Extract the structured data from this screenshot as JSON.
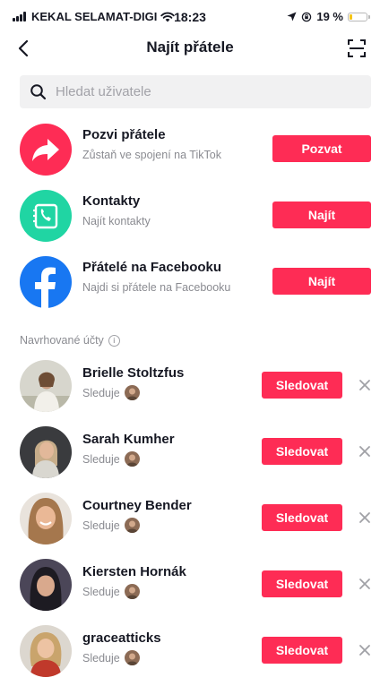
{
  "status_bar": {
    "carrier": "KEKAL SELAMAT-DIGI",
    "time": "18:23",
    "battery_text": "19 %",
    "battery_level_percent": 19,
    "icons": [
      "signal-bars-icon",
      "wifi-icon",
      "location-arrow-icon",
      "orientation-lock-icon",
      "battery-icon"
    ]
  },
  "header": {
    "title": "Najít přátele",
    "icons": [
      "back-arrow-icon",
      "qr-scan-icon"
    ]
  },
  "search": {
    "placeholder": "Hledat uživatele",
    "value": "",
    "icon": "search-icon"
  },
  "invite_options": [
    {
      "title": "Pozvi přátele",
      "subtitle": "Zůstaň ve spojení na TikTok",
      "button": "Pozvat",
      "icon": "share-arrow-icon",
      "color": "#fe2c55"
    },
    {
      "title": "Kontakty",
      "subtitle": "Najít kontakty",
      "button": "Najít",
      "icon": "contacts-phone-icon",
      "color": "#20d5a3"
    },
    {
      "title": "Přátelé na Facebooku",
      "subtitle": "Najdi si přátele na Facebooku",
      "button": "Najít",
      "icon": "facebook-icon",
      "color": "#1877f2"
    }
  ],
  "suggested": {
    "label": "Navrhované účty",
    "icon": "info-icon",
    "accounts": [
      {
        "name": "Brielle Stoltzfus",
        "status": "Sleduje",
        "button": "Sledovat"
      },
      {
        "name": "Sarah Kumher",
        "status": "Sleduje",
        "button": "Sledovat"
      },
      {
        "name": "Courtney Bender",
        "status": "Sleduje",
        "button": "Sledovat"
      },
      {
        "name": "Kiersten Hornák",
        "status": "Sleduje",
        "button": "Sledovat"
      },
      {
        "name": "graceatticks",
        "status": "Sleduje",
        "button": "Sledovat"
      }
    ]
  },
  "colors": {
    "accent": "#fe2c55",
    "text": "#161823",
    "secondary_text": "#8a8b91",
    "search_bg": "#f1f1f2"
  }
}
